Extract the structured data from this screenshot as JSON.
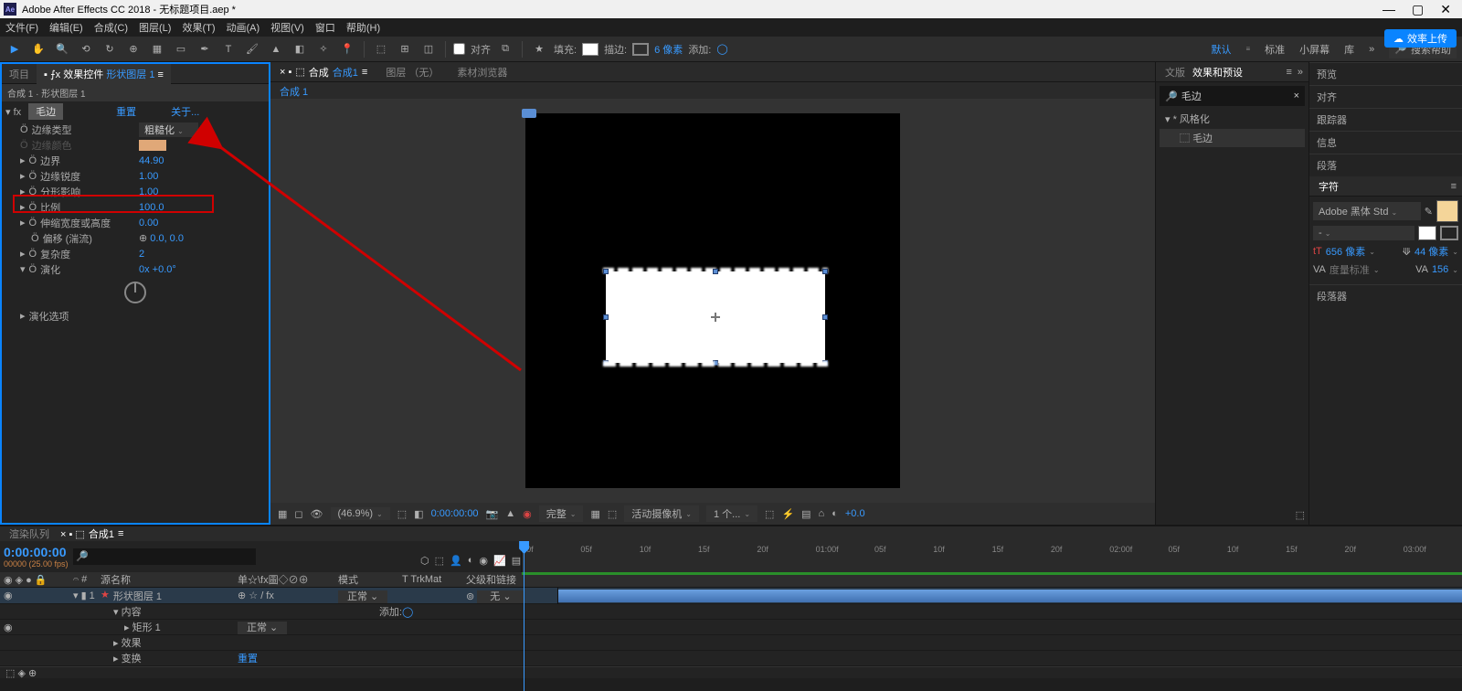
{
  "title": "Adobe After Effects CC 2018 - 无标题项目.aep *",
  "menu": [
    "文件(F)",
    "编辑(E)",
    "合成(C)",
    "图层(L)",
    "效果(T)",
    "动画(A)",
    "视图(V)",
    "窗口",
    "帮助(H)"
  ],
  "toolbar": {
    "snapping": "对齐",
    "fill": "填充:",
    "stroke": "描边:",
    "stroke_px": "6 像素",
    "add": "添加:"
  },
  "workspace": {
    "default": "默认",
    "standard": "标准",
    "small": "小屏幕",
    "lib": "库",
    "searchHelp": "搜索帮助",
    "cloud_upload": "效率上传"
  },
  "leftPanel": {
    "tabProject": "项目",
    "tabEffectControls": "效果控件",
    "tabLayer": "形状图层 1",
    "header": "合成 1 · 形状图层 1",
    "fx": "fx",
    "effectName": "毛边",
    "reset": "重置",
    "about": "关于...",
    "props": {
      "edgeType": {
        "label": "边缘类型",
        "value": "粗糙化"
      },
      "edgeColor": {
        "label": "边缘颜色"
      },
      "border": {
        "label": "边界",
        "value": "44.90"
      },
      "edgeSharp": {
        "label": "边缘锐度",
        "value": "1.00"
      },
      "fractal": {
        "label": "分形影响",
        "value": "1.00"
      },
      "scale": {
        "label": "比例",
        "value": "100.0"
      },
      "stretch": {
        "label": "伸缩宽度或高度",
        "value": "0.00"
      },
      "offset": {
        "label": "偏移 (湍流)",
        "value": "0.0, 0.0"
      },
      "complexity": {
        "label": "复杂度",
        "value": "2"
      },
      "evolution": {
        "label": "演化",
        "value": "0x +0.0°"
      },
      "evolutionOpts": {
        "label": "演化选项"
      }
    }
  },
  "center": {
    "tabComp": "合成",
    "tabCompName": "合成1",
    "tabLayer": "图层 （无）",
    "tabMedia": "素材浏览器",
    "compName": "合成 1",
    "footer": {
      "zoom": "(46.9%)",
      "time": "0:00:00:00",
      "full": "完整",
      "camera": "活动摄像机",
      "views": "1 个...",
      "exposure": "+0.0"
    }
  },
  "right1": {
    "tab1": "文版",
    "tab2": "效果和预设",
    "search": "毛边",
    "presetGroup": "* 风格化",
    "presetItem": "毛边"
  },
  "right2": {
    "sections": [
      "预览",
      "对齐",
      "跟踪器",
      "信息",
      "段落",
      "字符"
    ],
    "font": "Adobe 黑体 Std",
    "size": "656 像素",
    "spacing": "44 像素",
    "va_label": "度量标准",
    "va_val": "156",
    "paragraph": "段落器"
  },
  "timeline": {
    "tabQueue": "渲染队列",
    "tabComp": "合成1",
    "time": "0:00:00:00",
    "fps": "00000 (25.00 fps)",
    "cols": {
      "source": "源名称",
      "switches": "单☆\\fx圖◇⊘⊕",
      "mode": "模式",
      "trkmat": "T  TrkMat",
      "parent": "父级和链接"
    },
    "layer1": {
      "name": "形状图层 1",
      "mode": "正常",
      "parent": "无"
    },
    "contents": "内容",
    "addBtn": "添加:",
    "rect": "矩形 1",
    "rectMode": "正常",
    "effects": "效果",
    "transform": "变换",
    "resetLink": "重置",
    "ruler": [
      "00f",
      "05f",
      "10f",
      "15f",
      "20f",
      "01:00f",
      "05f",
      "10f",
      "15f",
      "20f",
      "02:00f",
      "05f",
      "10f",
      "15f",
      "20f",
      "03:00f"
    ]
  }
}
